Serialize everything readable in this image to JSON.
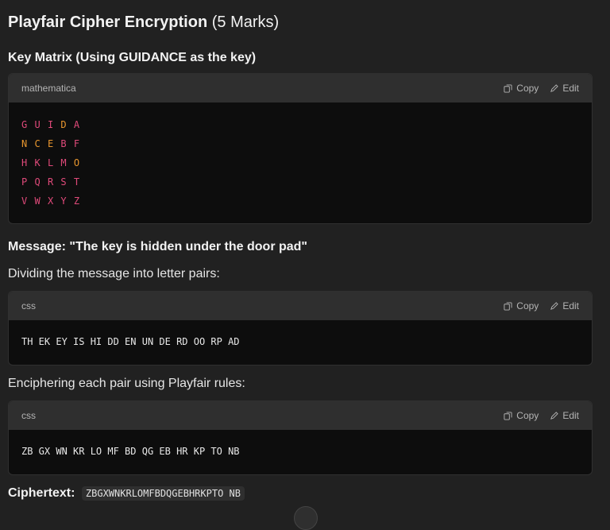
{
  "title": "Playfair Cipher Encryption",
  "title_marks": "(5 Marks)",
  "key_matrix_heading": "Key Matrix (Using GUIDANCE as the key)",
  "matrix_block": {
    "lang": "mathematica",
    "copy_label": "Copy",
    "edit_label": "Edit",
    "rows": [
      "G U I D A",
      "N C E B F",
      "H K L M O",
      "P Q R S T",
      "V W X Y Z"
    ]
  },
  "message_heading": "Message: \"The key is hidden under the door pad\"",
  "dividing_text": "Dividing the message into letter pairs:",
  "pairs_block": {
    "lang": "css",
    "copy_label": "Copy",
    "edit_label": "Edit",
    "code": "TH EK EY IS HI DD EN UN DE RD OO RP AD"
  },
  "enciphering_text": "Enciphering each pair using Playfair rules:",
  "enc_block": {
    "lang": "css",
    "copy_label": "Copy",
    "edit_label": "Edit",
    "code": "ZB GX WN KR LO MF BD QG EB HR KP TO NB"
  },
  "ciphertext_label": "Ciphertext:",
  "ciphertext_value": "ZBGXWNKRLOMFBDQGEBHRKPTO NB",
  "colors": {
    "background": "#212121",
    "code_bg": "#0d0d0d",
    "code_header": "#2f2f2f",
    "pink": "#e04a7a",
    "orange": "#e8962e"
  }
}
